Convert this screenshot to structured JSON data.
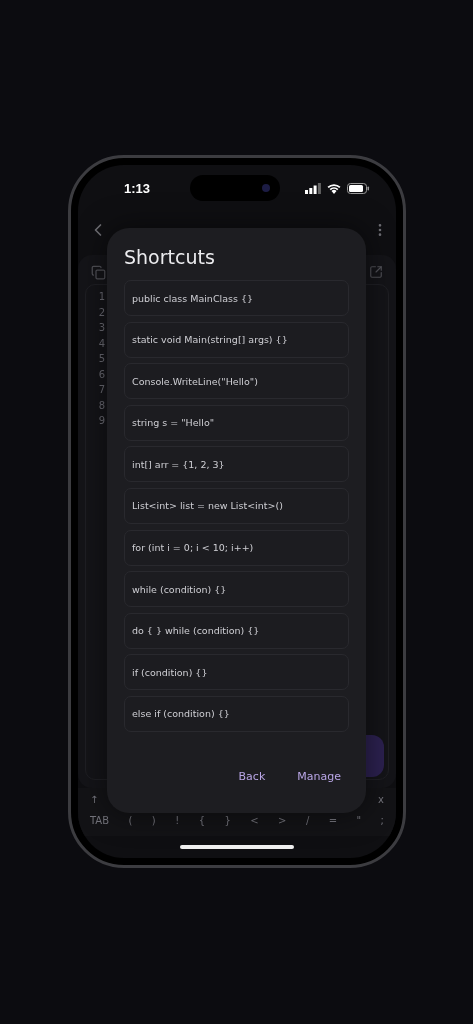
{
  "status_bar": {
    "time": "1:13"
  },
  "editor": {
    "line_numbers": [
      "1",
      "2",
      "3",
      "4",
      "5",
      "6",
      "7",
      "8",
      "9"
    ]
  },
  "keyboard": {
    "row_1": [
      "↑",
      "x"
    ],
    "row_2": [
      "TAB",
      "(",
      ")",
      "!",
      "{",
      "}",
      "<",
      ">",
      "/",
      "=",
      "\"",
      ";"
    ]
  },
  "dialog": {
    "title": "Shortcuts",
    "shortcuts": [
      "public class MainClass {}",
      "static void Main(string[] args) {}",
      "Console.WriteLine(\"Hello\")",
      "string s = \"Hello\"",
      "int[] arr = {1, 2, 3}",
      "List<int> list = new List<int>()",
      "for (int i = 0; i < 10; i++)",
      "while (condition) {}",
      "do { } while (condition) {}",
      "if (condition) {}",
      "else if (condition) {}"
    ],
    "buttons": [
      "Back",
      "Manage"
    ]
  }
}
